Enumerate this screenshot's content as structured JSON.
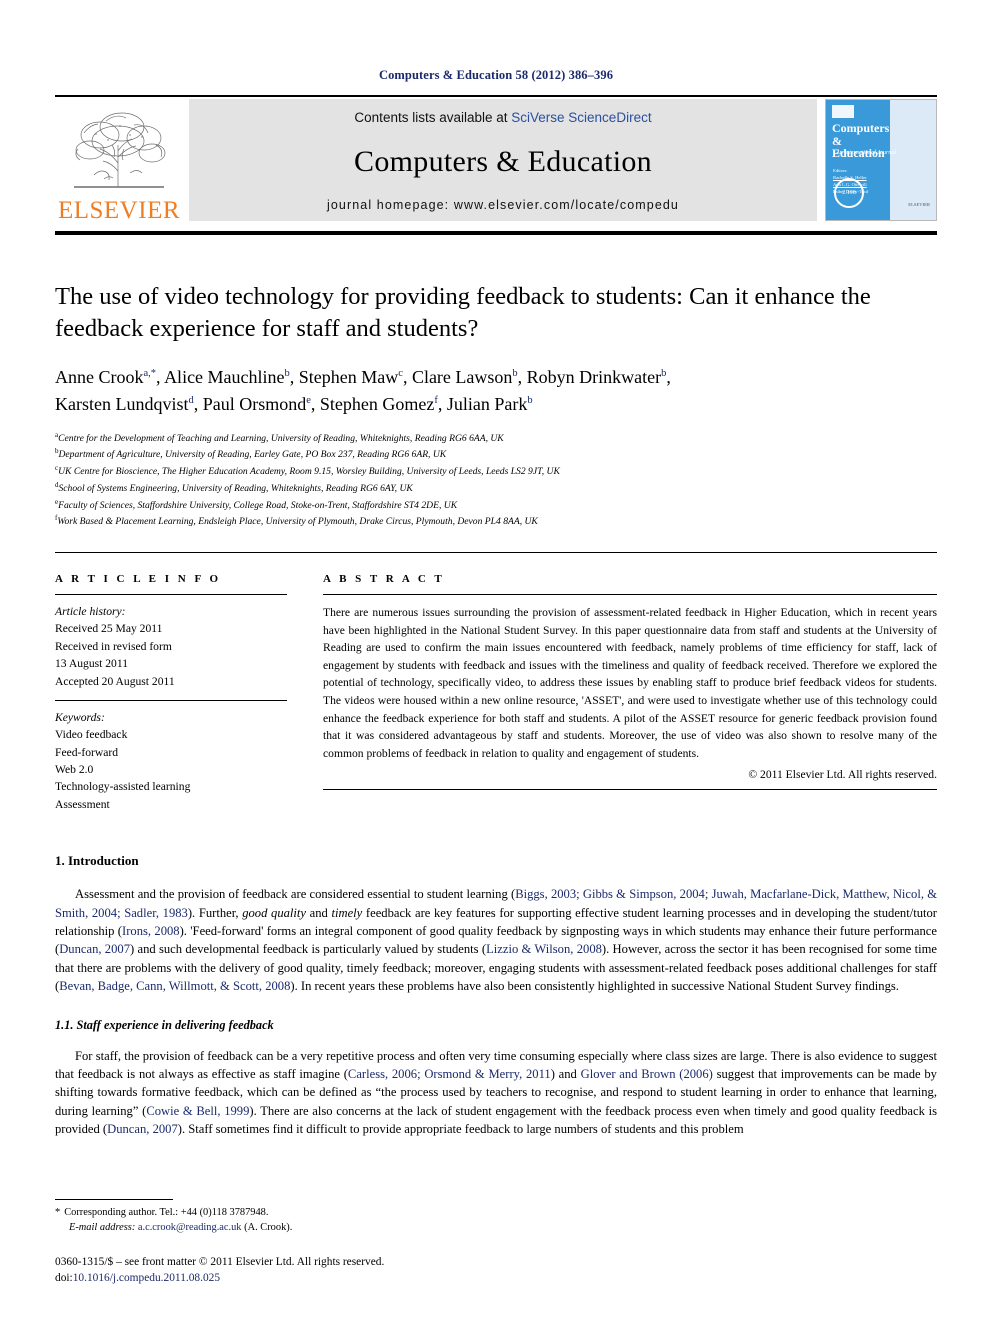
{
  "running_head": "Computers & Education 58 (2012) 386–396",
  "masthead": {
    "publisher_logo_text": "ELSEVIER",
    "contents_prefix": "Contents lists available at ",
    "contents_link": "SciVerse ScienceDirect",
    "journal_name": "Computers & Education",
    "homepage": "journal homepage: www.elsevier.com/locate/compedu",
    "cover": {
      "title_line1": "Computers",
      "title_amp": "&",
      "title_line2": "Education",
      "subtitle": "An International Journal",
      "editors_label": "Editors:",
      "editor1": "Rachelle S. Heller",
      "editor2": "Ann L.G. Ottewill",
      "editor3": "Esther Dorey-Tosif",
      "badge": "2.190",
      "footer": "ELSEVIER"
    }
  },
  "article": {
    "title": "The use of video technology for providing feedback to students: Can it enhance the feedback experience for staff and students?",
    "authors": [
      {
        "name": "Anne Crook",
        "sup": "a,*"
      },
      {
        "name": "Alice Mauchline",
        "sup": "b"
      },
      {
        "name": "Stephen Maw",
        "sup": "c"
      },
      {
        "name": "Clare Lawson",
        "sup": "b"
      },
      {
        "name": "Robyn Drinkwater",
        "sup": "b"
      },
      {
        "name": "Karsten Lundqvist",
        "sup": "d"
      },
      {
        "name": "Paul Orsmond",
        "sup": "e"
      },
      {
        "name": "Stephen Gomez",
        "sup": "f"
      },
      {
        "name": "Julian Park",
        "sup": "b"
      }
    ],
    "affiliations": [
      {
        "mark": "a",
        "text": "Centre for the Development of Teaching and Learning, University of Reading, Whiteknights, Reading RG6 6AA, UK"
      },
      {
        "mark": "b",
        "text": "Department of Agriculture, University of Reading, Earley Gate, PO Box 237, Reading RG6 6AR, UK"
      },
      {
        "mark": "c",
        "text": "UK Centre for Bioscience, The Higher Education Academy, Room 9.15, Worsley Building, University of Leeds, Leeds LS2 9JT, UK"
      },
      {
        "mark": "d",
        "text": "School of Systems Engineering, University of Reading, Whiteknights, Reading RG6 6AY, UK"
      },
      {
        "mark": "e",
        "text": "Faculty of Sciences, Staffordshire University, College Road, Stoke-on-Trent, Staffordshire ST4 2DE, UK"
      },
      {
        "mark": "f",
        "text": "Work Based & Placement Learning, Endsleigh Place, University of Plymouth, Drake Circus, Plymouth, Devon PL4 8AA, UK"
      }
    ]
  },
  "article_info": {
    "heading": "A R T I C L E   I N F O",
    "history_label": "Article history:",
    "history": [
      "Received 25 May 2011",
      "Received in revised form",
      "13 August 2011",
      "Accepted 20 August 2011"
    ],
    "keywords_label": "Keywords:",
    "keywords": [
      "Video feedback",
      "Feed-forward",
      "Web 2.0",
      "Technology-assisted learning",
      "Assessment"
    ]
  },
  "abstract": {
    "heading": "A B S T R A C T",
    "text": "There are numerous issues surrounding the provision of assessment-related feedback in Higher Education, which in recent years have been highlighted in the National Student Survey. In this paper questionnaire data from staff and students at the University of Reading are used to confirm the main issues encountered with feedback, namely problems of time efficiency for staff, lack of engagement by students with feedback and issues with the timeliness and quality of feedback received. Therefore we explored the potential of technology, specifically video, to address these issues by enabling staff to produce brief feedback videos for students. The videos were housed within a new online resource, 'ASSET', and were used to investigate whether use of this technology could enhance the feedback experience for both staff and students. A pilot of the ASSET resource for generic feedback provision found that it was considered advantageous by staff and students. Moreover, the use of video was also shown to resolve many of the common problems of feedback in relation to quality and engagement of students.",
    "copyright": "© 2011 Elsevier Ltd. All rights reserved."
  },
  "sections": {
    "intro_heading": "1. Introduction",
    "intro_p1": {
      "t1": "Assessment and the provision of feedback are considered essential to student learning (",
      "c1": "Biggs, 2003; Gibbs & Simpson, 2004; Juwah, Macfarlane-Dick, Matthew, Nicol, & Smith, 2004; Sadler, 1983",
      "t2": "). Further, ",
      "e1": "good quality",
      "t3": " and ",
      "e2": "timely",
      "t4": " feedback are key features for supporting effective student learning processes and in developing the student/tutor relationship (",
      "c2": "Irons, 2008",
      "t5": "). 'Feed-forward' forms an integral component of good quality feedback by signposting ways in which students may enhance their future performance (",
      "c3": "Duncan, 2007",
      "t6": ") and such developmental feedback is particularly valued by students (",
      "c4": "Lizzio & Wilson, 2008",
      "t7": "). However, across the sector it has been recognised for some time that there are problems with the delivery of good quality, timely feedback; moreover, engaging students with assessment-related feedback poses additional challenges for staff (",
      "c5": "Bevan, Badge, Cann, Willmott, & Scott, 2008",
      "t8": "). In recent years these problems have also been consistently highlighted in successive National Student Survey findings."
    },
    "sub_heading": "1.1. Staff experience in delivering feedback",
    "sub_p1": {
      "t1": "For staff, the provision of feedback can be a very repetitive process and often very time consuming especially where class sizes are large. There is also evidence to suggest that feedback is not always as effective as staff imagine (",
      "c1": "Carless, 2006; Orsmond & Merry, 2011",
      "t2": ") and ",
      "c2": "Glover and Brown (2006)",
      "t3": " suggest that improvements can be made by shifting towards formative feedback, which can be defined as “the process used by teachers to recognise, and respond to student learning in order to enhance that learning, during learning” (",
      "c3": "Cowie & Bell, 1999",
      "t4": "). There are also concerns at the lack of student engagement with the feedback process even when timely and good quality feedback is provided (",
      "c4": "Duncan, 2007",
      "t5": "). Staff sometimes find it difficult to provide appropriate feedback to large numbers of students and this problem"
    }
  },
  "footnotes": {
    "corresponding": "Corresponding author. Tel.: +44 (0)118 3787948.",
    "email_label": "E-mail address:",
    "email": "a.c.crook@reading.ac.uk",
    "email_suffix": "(A. Crook).",
    "issn_line": "0360-1315/$ – see front matter © 2011 Elsevier Ltd. All rights reserved.",
    "doi_label": "doi:",
    "doi": "10.1016/j.compedu.2011.08.025"
  },
  "colors": {
    "link_blue": "#1a2a6c",
    "sciencedirect_blue": "#2b4f9e",
    "elsevier_orange": "#ef7d22",
    "band_gray": "#e3e3e3",
    "cover_blue": "#3a9ad9"
  }
}
